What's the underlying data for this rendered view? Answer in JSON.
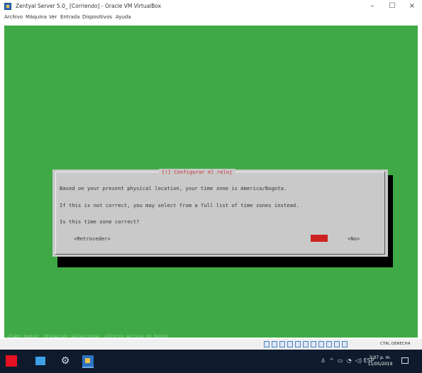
{
  "window": {
    "title": "Zentyal Server 5.0_ [Corriendo] - Oracle VM VirtualBox",
    "minimize": "–",
    "maximize": "☐",
    "close": "×"
  },
  "menu": [
    "Archivo",
    "Máquina",
    "Ver",
    "Entrada",
    "Dispositivos",
    "Ayuda"
  ],
  "dialog": {
    "title": "[!] Configurar el reloj",
    "line1": "Based on your present physical location, your time zone is America/Bogota.",
    "line2": "If this is not correct, you may select from a full list of time zones instead.",
    "line3": "Is this time zone correct?",
    "back": "<Retroceder>",
    "yes": "<Sí>",
    "no": "<No>"
  },
  "helpline": "<Tab> mueve; <Espacio> selecciona; <Intro> activa un botón",
  "statusbar": {
    "hostkey": "CTRL DERECHA"
  },
  "taskbar": {
    "time": "3:07 p. m.",
    "date": "11/05/2019",
    "language": "ESP"
  },
  "colors": {
    "screen_bg": "#3faa45",
    "dialog_bg": "#c9c9c9",
    "dialog_title": "#c8363a",
    "yes_button": "#cc2222",
    "taskbar": "#0f1b2c"
  }
}
